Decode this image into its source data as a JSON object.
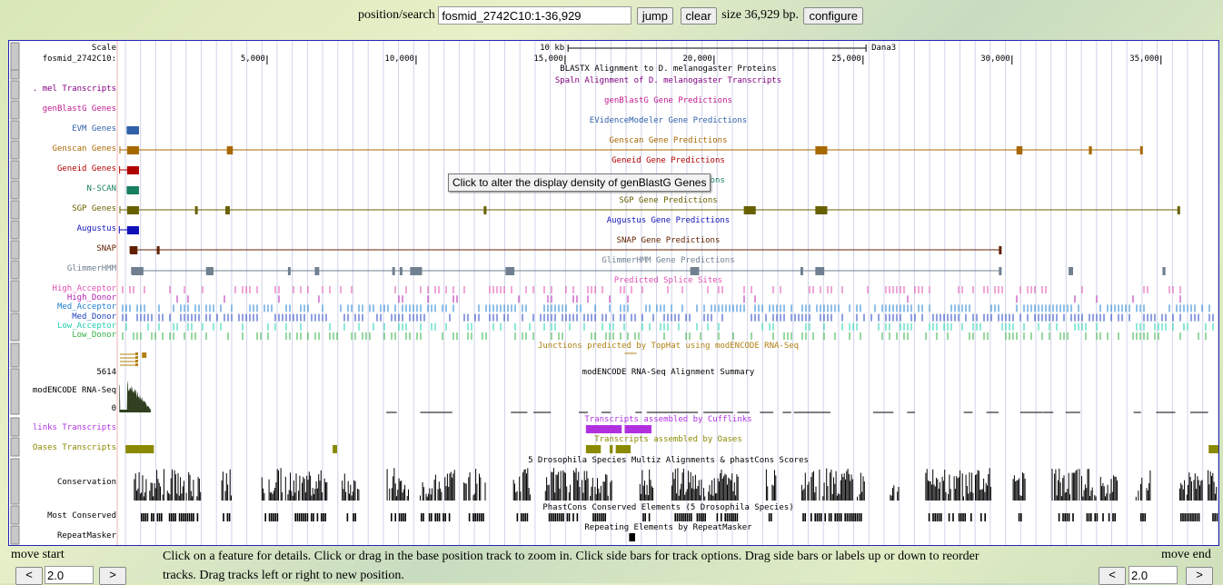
{
  "top": {
    "label": "position/search",
    "position": "fosmid_2742C10:1-36,929",
    "jump": "jump",
    "clear": "clear",
    "size_text": "size 36,929 bp.",
    "configure": "configure"
  },
  "tooltip": "Click to alter the display density of genBlastG Genes",
  "ruler": {
    "scale_label": "Scale",
    "chrom_label": "fosmid_2742C10:",
    "scale_bar": "10 kb",
    "assembly": "Dana3",
    "ticks": [
      {
        "bp": 5000,
        "label": "5,000"
      },
      {
        "bp": 10000,
        "label": "10,000"
      },
      {
        "bp": 15000,
        "label": "15,000"
      },
      {
        "bp": 20000,
        "label": "20,000"
      },
      {
        "bp": 25000,
        "label": "25,000"
      },
      {
        "bp": 30000,
        "label": "30,000"
      },
      {
        "bp": 35000,
        "label": "35,000"
      }
    ],
    "length": 36929
  },
  "tracks": [
    {
      "label": "",
      "title": "BLASTX Alignment to D. melanogaster Proteins",
      "color": "#000000"
    },
    {
      "label": ". mel Transcripts",
      "title": "Spaln Alignment of D. melanogaster Transcripts",
      "color": "#800080"
    },
    {
      "label": "genBlastG Genes",
      "title": "genBlastG Gene Predictions",
      "color": "#c0188c"
    },
    {
      "label": "EVM Genes",
      "title": "EVidenceModeler Gene Predictions",
      "color": "#3060a8"
    },
    {
      "label": "Genscan Genes",
      "title": "Genscan Gene Predictions",
      "color": "#a86800"
    },
    {
      "label": "Geneid Genes",
      "title": "Geneid Gene Predictions",
      "color": "#b00000"
    },
    {
      "label": "N-SCAN",
      "title": "N-SCAN Gene Predictions",
      "color": "#188060"
    },
    {
      "label": "SGP Genes",
      "title": "SGP Gene Predictions",
      "color": "#686000"
    },
    {
      "label": "Augustus",
      "title": "Augustus Gene Predictions",
      "color": "#1010b8"
    },
    {
      "label": "SNAP",
      "title": "SNAP Gene Predictions",
      "color": "#602000"
    },
    {
      "label": "GlimmerHMM",
      "title": "GlimmerHMM Gene Predictions",
      "color": "#708090"
    }
  ],
  "genes": [
    {
      "track": 3,
      "start": 300,
      "end": 700,
      "exons": [
        [
          300,
          700
        ]
      ]
    },
    {
      "track": 4,
      "start": 60,
      "end": 34340,
      "exons": [
        [
          300,
          700
        ],
        [
          3650,
          3850
        ],
        [
          23400,
          23800
        ],
        [
          30150,
          30350
        ],
        [
          32580,
          32680
        ],
        [
          34300,
          34360
        ]
      ]
    },
    {
      "track": 5,
      "start": 50,
      "end": 700,
      "exons": [
        [
          300,
          700
        ]
      ]
    },
    {
      "track": 6,
      "start": 300,
      "end": 700,
      "exons": [
        [
          300,
          700
        ]
      ]
    },
    {
      "track": 7,
      "start": 60,
      "end": 35600,
      "exons": [
        [
          300,
          700
        ],
        [
          2580,
          2650
        ],
        [
          3600,
          3750
        ],
        [
          12270,
          12320
        ],
        [
          21000,
          21400
        ],
        [
          23400,
          23800
        ],
        [
          35550,
          35620
        ]
      ]
    },
    {
      "track": 8,
      "start": 40,
      "end": 700,
      "exons": [
        [
          300,
          700
        ]
      ]
    },
    {
      "track": 9,
      "start": 400,
      "end": 29620,
      "exons": [
        [
          400,
          650
        ],
        [
          1300,
          1340
        ],
        [
          29560,
          29640
        ]
      ]
    },
    {
      "track": 10,
      "start": 450,
      "end": 29620,
      "exons": [
        [
          450,
          850
        ],
        [
          2950,
          3200
        ],
        [
          5700,
          5760
        ],
        [
          6600,
          6750
        ],
        [
          9200,
          9260
        ],
        [
          9450,
          9500
        ],
        [
          9800,
          10200
        ],
        [
          13000,
          13300
        ],
        [
          19200,
          19500
        ],
        [
          22900,
          22950
        ],
        [
          23400,
          23700
        ],
        [
          29560,
          29620
        ],
        [
          31900,
          32050
        ],
        [
          35050,
          35150
        ]
      ]
    }
  ],
  "splice": {
    "title": "Predicted Splice Sites",
    "rows": [
      {
        "label": "High_Acceptor",
        "color": "#e050b0"
      },
      {
        "label": "High_Donor",
        "color": "#b020b0"
      },
      {
        "label": "Med_Acceptor",
        "color": "#2080d0"
      },
      {
        "label": "Med_Donor",
        "color": "#2040c0"
      },
      {
        "label": "Low_Acceptor",
        "color": "#20d0b0"
      },
      {
        "label": "Low_Donor",
        "color": "#30b040"
      }
    ]
  },
  "junctions": {
    "title": "Junctions predicted by TopHat using modENCODE RNA-Seq",
    "color": "#b08010"
  },
  "rnaseq": {
    "label": "modENCODE RNA-Seq",
    "title": "modENCODE RNA-Seq Alignment Summary",
    "max": "5614",
    "min": "0",
    "color": "#304020"
  },
  "cufflinks": {
    "label": "links Transcripts",
    "title": "Transcripts assembled by Cufflinks",
    "color": "#b030e0",
    "features": [
      [
        15700,
        16900
      ],
      [
        17000,
        17900
      ]
    ]
  },
  "oases": {
    "label": "Oases Transcripts",
    "title": "Transcripts assembled by Oases",
    "color": "#8a8a00",
    "features": [
      [
        250,
        1200
      ],
      [
        7200,
        7350
      ],
      [
        15700,
        16200
      ],
      [
        16500,
        16600
      ],
      [
        16700,
        17200
      ],
      [
        36600,
        36929
      ]
    ]
  },
  "conservation": {
    "label": "Conservation",
    "title": "5 Drosophila Species Multiz Alignments & phastCons Scores"
  },
  "most_conserved": {
    "label": "Most Conserved",
    "title": "PhastCons Conserved Elements (5 Drosophila Species)"
  },
  "repeat": {
    "label": "RepeatMasker",
    "title": "Repeating Elements by RepeatMasker",
    "features": [
      [
        17150,
        17350
      ]
    ]
  },
  "footer": {
    "move_start": "move start",
    "move_end": "move end",
    "start_value": "2.0",
    "end_value": "2.0",
    "left": "<",
    "right": ">",
    "help": "Click on a feature for details. Click or drag in the base position track to zoom in. Click side bars for track options. Drag side bars or labels up or down to reorder",
    "help2": "tracks. Drag tracks left or right to new position."
  }
}
